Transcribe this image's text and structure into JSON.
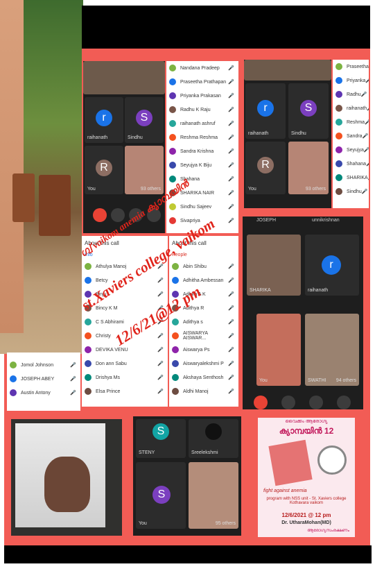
{
  "overlay": {
    "line1": "ഗ്വ് vaikom anemia ക്യാമ്പയിൻ",
    "line2": "st.Xaviers college, vaikom",
    "line3": "12/6/21@12 pm"
  },
  "panel_top_mid": {
    "tiles": [
      "raihanath",
      "Sindhu",
      "You"
    ],
    "others": "93 others"
  },
  "people_list_1": [
    "Nandana Pradeep",
    "Praseetha Prathapan",
    "Priyanka Prakasan",
    "Radhu K Raju",
    "raihanath ashruf",
    "Reshma Reshma",
    "Sandra Krishna",
    "Seyujya K Biju",
    "Shahana",
    "SHARIKA NAIR",
    "Sindhu Sajeev",
    "Sivapriya"
  ],
  "people_list_2": [
    "Praseetha",
    "Priyanka",
    "Radhu",
    "raihanath",
    "Reshma",
    "Sandra",
    "Seyujya",
    "Shahana",
    "SHARIKA",
    "Sindhu"
  ],
  "panel_top_right": {
    "tiles": [
      "raihanath",
      "Sindhu",
      "You"
    ],
    "others": "93 others"
  },
  "about": {
    "header1": "About this call",
    "header2": "About this call",
    "tab_people": "People",
    "tab_info": "Info"
  },
  "people_list_3": [
    "Athulya Manoj",
    "Betcy",
    "Binju",
    "Bincy K M",
    "C S Abhirami",
    "Christy",
    "DEVIKA VENU",
    "Don ann Sabu",
    "Drishya Ms",
    "Elsa Prince"
  ],
  "people_list_4": [
    "Abin Shibu",
    "Adhitha Ambessan",
    "Adhira A K",
    "Adithya R",
    "Adithya s",
    "AISWARYA AISWAR...",
    "Aiswarya Ps",
    "Aiswaryalekshmi P",
    "Akshaya Senthosh",
    "Aldhi Manoj"
  ],
  "bottom_list_left": [
    "Jomol Johnson",
    "JOSEPH ABEY",
    "Austin Antony"
  ],
  "mid_right_panel": {
    "top_left": "JOSEPH",
    "top_right": "unnikrishnan",
    "tiles": [
      "SHARIKA",
      "raihanath",
      "You",
      "SWATHI"
    ],
    "others": "94 others"
  },
  "bottom_panel": {
    "tiles": [
      "STENY",
      "Sreelekshmi",
      "You"
    ],
    "others": "95 others"
  },
  "poster": {
    "title_top": "ക്യാമ്പയിൻ 12",
    "subtitle": "വൈക്കം ആരോഗ്യ",
    "line_fight": "fight against anemia",
    "line_prog": "program with NSS unit - St. Xaviers college Kothavara vaikom",
    "date": "12/6/2021 @ 12 pm",
    "doctor": "Dr. UtharaMohan(MD)",
    "footer": "ആരോഗ്യസംരക്ഷണം"
  },
  "colors": {
    "frame": "#f25c55",
    "panel": "#1e1e1e",
    "overlay_text": "#e0241b",
    "avatar_blue": "#1a73e8",
    "avatar_purple": "#7b3fbf",
    "avatar_teal": "#12a4a4",
    "avatar_brown": "#8d6e63"
  }
}
